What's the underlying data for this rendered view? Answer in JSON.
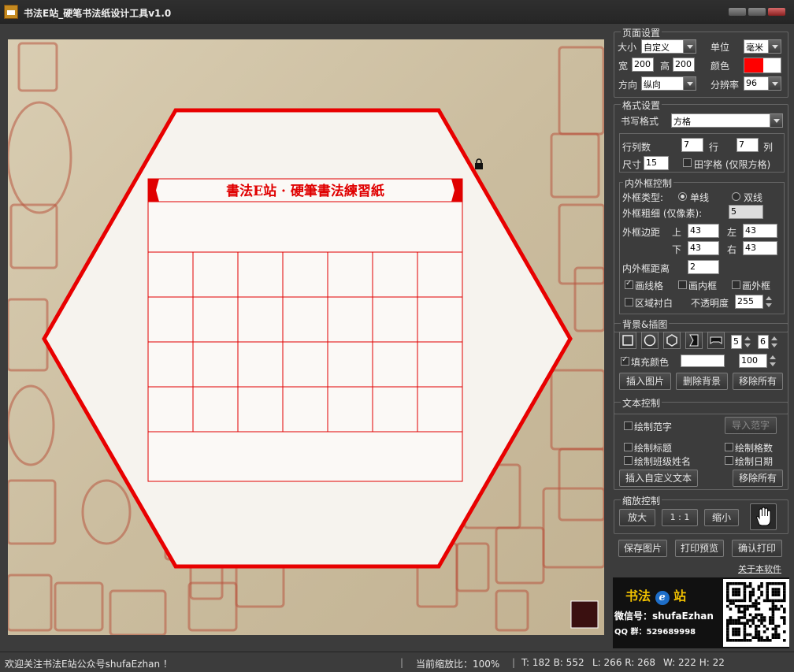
{
  "window": {
    "title": "书法E站_硬笔书法纸设计工具v1.0"
  },
  "paper": {
    "title": "書法E站 · 硬筆書法練習紙",
    "rows": 7,
    "cols": 7,
    "accent_color": "#e00000",
    "lock_icon": "lock-icon",
    "background": "ancient seal stamps painting"
  },
  "page_settings": {
    "title": "页面设置",
    "size_label": "大小",
    "size_value": "自定义",
    "unit_label": "单位",
    "unit_value": "毫米",
    "width_label": "宽",
    "width_value": "200",
    "height_label": "高",
    "height_value": "200",
    "color_label": "颜色",
    "color_value": "#ff0000",
    "direction_label": "方向",
    "direction_value": "纵向",
    "dpi_label": "分辨率",
    "dpi_value": "96"
  },
  "format_settings": {
    "title": "格式设置",
    "style_label": "书写格式",
    "style_value": "方格",
    "rowcol_label": "行列数",
    "rows_value": "7",
    "rows_unit": "行",
    "cols_value": "7",
    "cols_unit": "列",
    "size_label": "尺寸",
    "size_value": "15",
    "tianzige_label": "田字格 (仅限方格)"
  },
  "frame_control": {
    "title": "内外框控制",
    "type_label": "外框类型:",
    "single_label": "单线",
    "double_label": "双线",
    "thickness_label": "外框粗细 (仅像素):",
    "thickness_value": "5",
    "margin_label": "外框边距",
    "top_label": "上",
    "top_value": "43",
    "left_label": "左",
    "left_value": "43",
    "bottom_label": "下",
    "bottom_value": "43",
    "right_label": "右",
    "right_value": "43",
    "inner_dist_label": "内外框距离",
    "inner_dist_value": "2",
    "draw_grid_label": "画线格",
    "draw_inner_label": "画内框",
    "draw_outer_label": "画外框",
    "area_white_label": "区域衬白",
    "opacity_label": "不透明度",
    "opacity_value": "255"
  },
  "background_control": {
    "title": "背景&插图",
    "shape_icons": [
      "square-icon",
      "circle-icon",
      "hexagon-icon",
      "left-notch-icon",
      "scroll-icon"
    ],
    "spin_a": "5",
    "spin_b": "6",
    "fill_label": "填充颜色",
    "fill_value": "100",
    "insert_image": "插入图片",
    "delete_bg": "删除背景",
    "remove_all": "移除所有"
  },
  "text_control": {
    "title": "文本控制",
    "draw_sample": "绘制范字",
    "import_sample": "导入范字",
    "draw_title": "绘制标题",
    "draw_grid_num": "绘制格数",
    "draw_class_name": "绘制班级姓名",
    "draw_date": "绘制日期",
    "insert_text": "插入自定义文本",
    "remove_all": "移除所有"
  },
  "zoom_control": {
    "title": "缩放控制",
    "zoom_in": "放大",
    "one_to_one": "1 : 1",
    "zoom_out": "缩小",
    "hand_icon": "hand-icon"
  },
  "actions": {
    "save": "保存图片",
    "print_preview": "打印预览",
    "confirm_print": "确认打印",
    "about": "关于本软件"
  },
  "ad": {
    "brand": "书法",
    "brand_e": "e",
    "brand_tail": "站",
    "wechat": "微信号：shufaEzhan",
    "qq": "QQ 群：529689998"
  },
  "status": {
    "message": "欢迎关注书法E站公众号shufaEzhan ！",
    "zoom": "当前缩放比：100%",
    "tb": "T: 182 B: 552",
    "lr": "L: 266 R: 268",
    "wh": "W: 222 H: 22"
  }
}
